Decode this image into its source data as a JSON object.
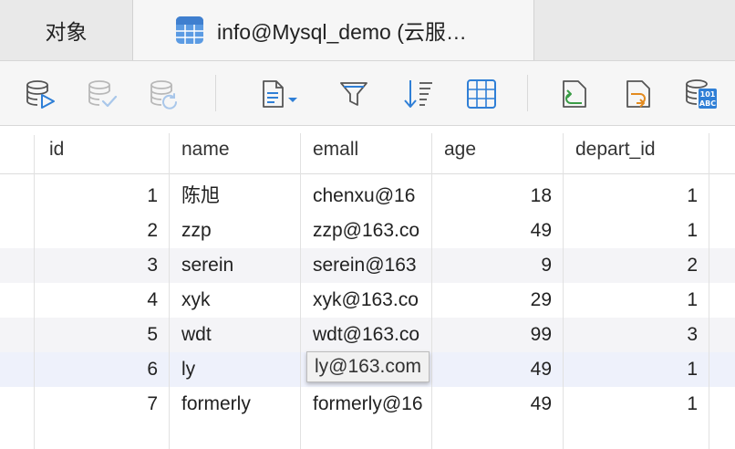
{
  "tabs": {
    "objects_label": "对象",
    "query_label": "info@Mysql_demo (云服…"
  },
  "toolbar": {
    "icons": [
      "run-query-icon",
      "save-disabled-icon",
      "refresh-disabled-icon",
      "text-dropdown-icon",
      "filter-icon",
      "sort-icon",
      "grid-view-icon",
      "import-icon",
      "export-icon",
      "data-generation-icon"
    ]
  },
  "table": {
    "columns": [
      "id",
      "name",
      "emall",
      "age",
      "depart_id"
    ],
    "rows": [
      {
        "id": "1",
        "name": "陈旭",
        "emall": "chenxu@16",
        "age": "18",
        "depart_id": "1"
      },
      {
        "id": "2",
        "name": "zzp",
        "emall": "zzp@163.co",
        "age": "49",
        "depart_id": "1"
      },
      {
        "id": "3",
        "name": "serein",
        "emall": "serein@163",
        "age": "9",
        "depart_id": "2"
      },
      {
        "id": "4",
        "name": "xyk",
        "emall": "xyk@163.co",
        "age": "29",
        "depart_id": "1"
      },
      {
        "id": "5",
        "name": "wdt",
        "emall": "wdt@163.co",
        "age": "99",
        "depart_id": "3"
      },
      {
        "id": "6",
        "name": "ly",
        "emall": "ly@163.com",
        "age": "49",
        "depart_id": "1"
      },
      {
        "id": "7",
        "name": "formerly",
        "emall": "formerly@16",
        "age": "49",
        "depart_id": "1"
      }
    ]
  },
  "tooltip": "ly@163.com",
  "colors": {
    "accent": "#2f7fd6",
    "sync": "#3a9c46",
    "orange": "#e38a1e"
  }
}
